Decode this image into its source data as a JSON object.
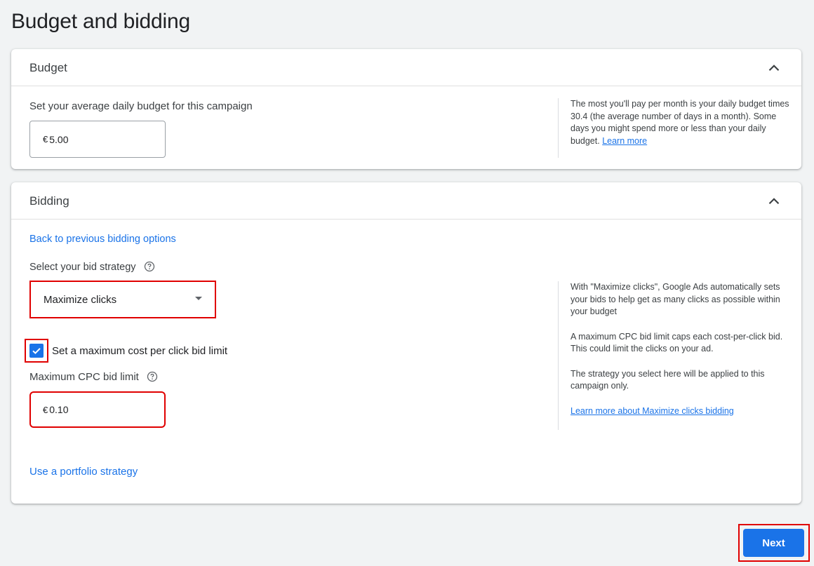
{
  "page": {
    "title": "Budget and bidding"
  },
  "budget": {
    "header": "Budget",
    "field_label": "Set your average daily budget for this campaign",
    "currency": "€",
    "amount": "5.00",
    "note_text": "The most you'll pay per month is your daily budget times 30.4 (the average number of days in a month). Some days you might spend more or less than your daily budget.",
    "note_link": "Learn more"
  },
  "bidding": {
    "header": "Bidding",
    "back_link": "Back to previous bidding options",
    "strategy_label": "Select your bid strategy",
    "strategy_selected": "Maximize clicks",
    "checkbox_label": "Set a maximum cost per click bid limit",
    "checkbox_checked": true,
    "cpc_label": "Maximum CPC bid limit",
    "cpc_currency": "€",
    "cpc_amount": "0.10",
    "portfolio_link": "Use a portfolio strategy",
    "notes": [
      "With \"Maximize clicks\", Google Ads automatically sets your bids to help get as many clicks as possible within your budget",
      "A maximum CPC bid limit caps each cost-per-click bid. This could limit the clicks on your ad.",
      "The strategy you select here will be applied to this campaign only."
    ],
    "notes_link": "Learn more about Maximize clicks bidding"
  },
  "footer": {
    "next_label": "Next"
  },
  "colors": {
    "accent": "#1a73e8",
    "highlight": "#e00000",
    "background": "#f1f3f4"
  },
  "icons": {
    "collapse": "chevron-up-icon",
    "help": "help-circle-icon",
    "check": "check-icon",
    "dropdown": "dropdown-arrow-icon"
  }
}
